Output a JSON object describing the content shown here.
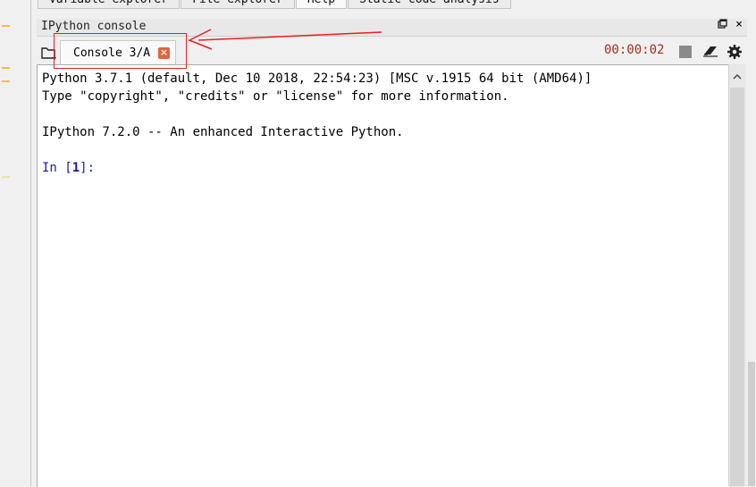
{
  "top_tabs": [
    {
      "label": "Variable explorer",
      "active": false
    },
    {
      "label": "File explorer",
      "active": false
    },
    {
      "label": "Help",
      "active": true
    },
    {
      "label": "Static code analysis",
      "active": false
    }
  ],
  "pane": {
    "title": "IPython console",
    "undock_icon": "undock-icon",
    "close_icon": "close-icon",
    "close_glyph": "×"
  },
  "toolbar": {
    "folder_icon": "folder-icon",
    "console_tab": {
      "label": "Console 3/A",
      "close_glyph": "×"
    },
    "timer": "00:00:02",
    "stop_icon": "stop-icon",
    "clear_icon": "eraser-icon",
    "options_icon": "gear-icon"
  },
  "console": {
    "line1": "Python 3.7.1 (default, Dec 10 2018, 22:54:23) [MSC v.1915 64 bit (AMD64)]",
    "line2": "Type \"copyright\", \"credits\" or \"license\" for more information.",
    "line3": "IPython 7.2.0 -- An enhanced Interactive Python.",
    "prompt_prefix": "In [",
    "prompt_number": "1",
    "prompt_suffix": "]:"
  },
  "annotation": {
    "color": "#e82020"
  },
  "colors": {
    "timer": "#a0301e",
    "prompt": "#1a1aa6",
    "tab_close": "#e0653a"
  }
}
